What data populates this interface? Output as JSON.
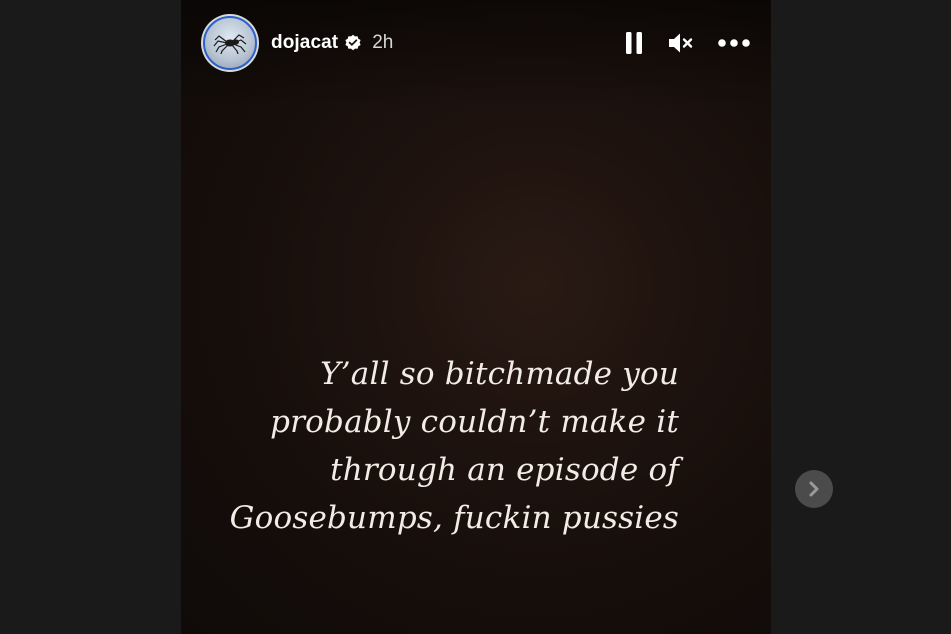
{
  "story": {
    "username": "dojacat",
    "time": "2h",
    "verified": true,
    "caption_lines": [
      "Y’all so bitchmade you",
      "probably couldn’t make it",
      "through an episode of",
      "Goosebumps, fuckin pussies"
    ]
  },
  "controls": {
    "pause_icon": "pause-icon",
    "mute_icon": "speaker-muted-icon",
    "more_icon": "more-horizontal-icon"
  },
  "navigation": {
    "next_icon": "chevron-right-icon"
  },
  "colors": {
    "page_background": "#1a1a1a",
    "story_background": "#1d120e",
    "caption_text": "#f2ece6",
    "next_button": "#4b4b4b"
  }
}
